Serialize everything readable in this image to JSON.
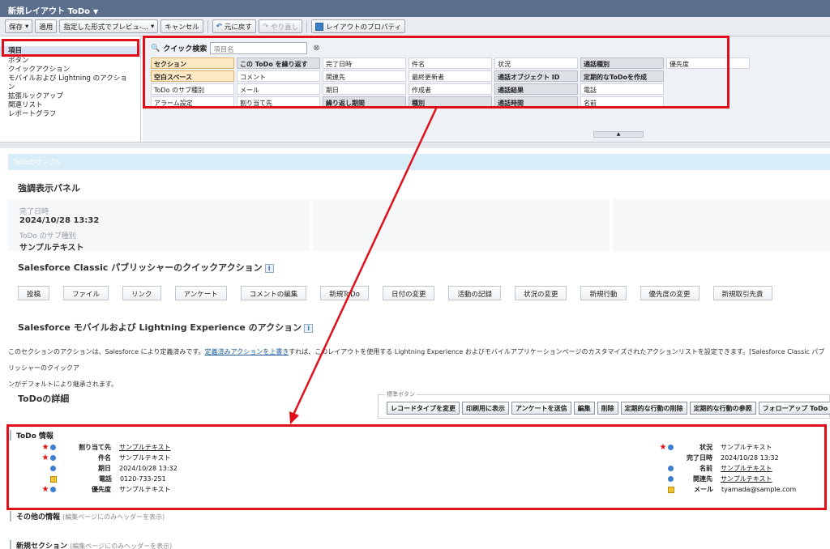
{
  "window": {
    "title": "新規レイアウト ToDo"
  },
  "toolbar": {
    "save": "保存",
    "apply": "適用",
    "preview": "指定した形式でプレビュ-...",
    "cancel": "キャンセル",
    "undo": "元に戻す",
    "redo": "やり直し",
    "layout_properties": "レイアウトのプロパティ"
  },
  "palette": {
    "categories": [
      "項目",
      "ボタン",
      "クイックアクション",
      "モバイルおよび Lightning のアクション",
      "拡張ルックアップ",
      "関連リスト",
      "レポートグラフ"
    ],
    "quick_search_label": "クイック検索",
    "quick_search_placeholder": "項目名",
    "rows": [
      [
        "セクション",
        "この ToDo を繰り返す",
        "完了日時",
        "件名",
        "状況",
        "通話種別",
        "優先度"
      ],
      [
        "空白スペース",
        "コメント",
        "関連先",
        "最終更新者",
        "通話オブジェクト ID",
        "定期的なToDoを作成",
        ""
      ],
      [
        "ToDo のサブ種別",
        "メール",
        "期日",
        "作成者",
        "通話結果",
        "電話",
        ""
      ],
      [
        "アラーム設定",
        "割り当て先",
        "繰り返し期間",
        "種別",
        "通話時間",
        "名前",
        ""
      ]
    ]
  },
  "sample": {
    "bar_label": "ToDoのサンプル",
    "highlight_title": "強調表示パネル",
    "hl_fields": [
      {
        "label": "完了日時",
        "value": "2024/10/28 13:32"
      },
      {
        "label": "ToDo のサブ種別",
        "value": "サンプルテキスト"
      }
    ],
    "classic_actions_title": "Salesforce Classic パブリッシャーのクイックアクション",
    "classic_actions": [
      "投稿",
      "ファイル",
      "リンク",
      "アンケート",
      "コメントの編集",
      "新規ToDo",
      "日付の変更",
      "活動の記録",
      "状況の変更",
      "新規行動",
      "優先度の変更",
      "新規取引先責"
    ],
    "mobile_actions_title": "Salesforce モバイルおよび Lightning Experience のアクション",
    "mobile_paragraph_1": "このセクションのアクションは、Salesforce により定義済みです。",
    "mobile_paragraph_link": "定義済みアクションを上書き",
    "mobile_paragraph_2": "すれば、このレイアウトを使用する Lightning Experience およびモバイルアプリケーションページのカスタマイズされたアクションリストを設定できます。[Salesforce Classic パブリッシャーのクイックア",
    "mobile_paragraph_3": "ンがデフォルトにより継承されます。",
    "details_title": "ToDoの詳細",
    "std_buttons_legend": "標準ボタン",
    "std_buttons": [
      "レコードタイプを変更",
      "印刷用に表示",
      "アンケートを送信",
      "編集",
      "削除",
      "定期的な行動の削除",
      "定期的な行動の参照",
      "フォローアップ ToDo"
    ]
  },
  "todo_info": {
    "title": "ToDo 情報",
    "left_fields": [
      {
        "label": "割り当て先",
        "value": "サンプルテキスト"
      },
      {
        "label": "件名",
        "value": "サンプルテキスト"
      },
      {
        "label": "期日",
        "value": "2024/10/28 13:32"
      },
      {
        "label": "電話",
        "value": "0120-733-251"
      },
      {
        "label": "優先度",
        "value": "サンプルテキスト"
      }
    ],
    "right_fields": [
      {
        "label": "状況",
        "value": "サンプルテキスト"
      },
      {
        "label": "完了日時",
        "value": "2024/10/28 13:32"
      },
      {
        "label": "名前",
        "value": "サンプルテキスト"
      },
      {
        "label": "関連先",
        "value": "サンプルテキスト"
      },
      {
        "label": "メール",
        "value": "tyamada@sample.com"
      }
    ],
    "other_info": "その他の情報",
    "other_info_sub": "(編集ページにのみヘッダーを表示)",
    "new_section": "新規セクション",
    "new_section_sub": "(編集ページにのみヘッダーを表示)"
  },
  "colors": {
    "annotation_red": "#e0101a",
    "titlebar": "#5b6f8c"
  }
}
